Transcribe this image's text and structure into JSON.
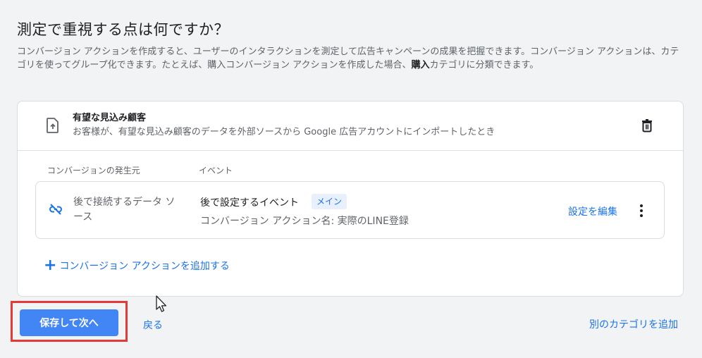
{
  "heading": {
    "title": "測定で重視する点は何ですか？",
    "description_part1": "コンバージョン アクションを作成すると、ユーザーのインタラクションを測定して広告キャンペーンの成果を把握できます。コンバージョン アクションは、カテゴリを使ってグループ化できます。たとえば、購入コンバージョン アクションを作成した場合、",
    "description_bold": "購入",
    "description_part2": "カテゴリに分類できます。"
  },
  "category": {
    "icon": "upload-file-icon",
    "title": "有望な見込み顧客",
    "subtitle": "お客様が、有望な見込み顧客のデータを外部ソースから Google 広告アカウントにインポートしたとき",
    "delete_icon": "trash-icon"
  },
  "table": {
    "col_source": "コンバージョンの発生元",
    "col_event": "イベント",
    "rows": [
      {
        "source_icon": "link-off-icon",
        "source": "後で接続するデータ ソース",
        "event": "後で設定するイベント",
        "badge": "メイン",
        "action_name": "コンバージョン アクション名: 実際のLINE登録",
        "edit_label": "設定を編集",
        "more_icon": "more-vert-icon"
      }
    ]
  },
  "add_action": {
    "icon": "plus-icon",
    "label": "コンバージョン アクションを追加する"
  },
  "footer": {
    "save_label": "保存して次へ",
    "back_label": "戻る",
    "add_category_label": "別のカテゴリを追加"
  },
  "colors": {
    "accent": "#1a73e8",
    "primary_button": "#4285f4",
    "highlight_border": "#e53935",
    "badge_bg": "#e8f0fe"
  }
}
